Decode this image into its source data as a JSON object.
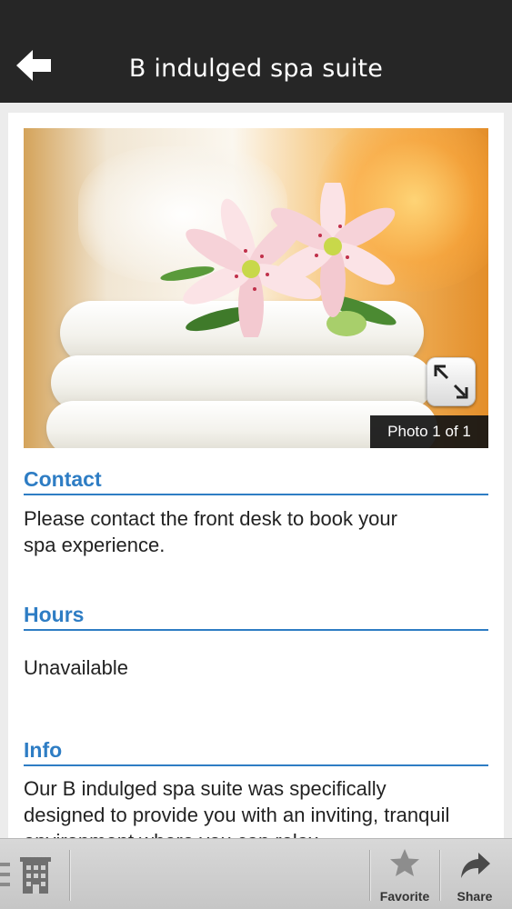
{
  "header": {
    "title": "B indulged spa suite",
    "back_icon": "back-arrow-icon"
  },
  "photo": {
    "counter": "Photo 1 of 1",
    "expand_icon": "expand-icon"
  },
  "sections": {
    "contact": {
      "heading": "Contact",
      "body": "Please contact the front desk to book your spa experience."
    },
    "hours": {
      "heading": "Hours",
      "body": "Unavailable"
    },
    "info": {
      "heading": "Info",
      "body": "Our B indulged spa suite was specifically designed to provide you with an inviting, tranquil environment where you can relax"
    }
  },
  "tabbar": {
    "menu_icon": "list-menu-icon",
    "hotel_icon": "building-icon",
    "favorite_label": "Favorite",
    "share_label": "Share"
  },
  "colors": {
    "header_bg": "#262626",
    "accent": "#2e7dc4",
    "page_bg": "#ececec"
  }
}
